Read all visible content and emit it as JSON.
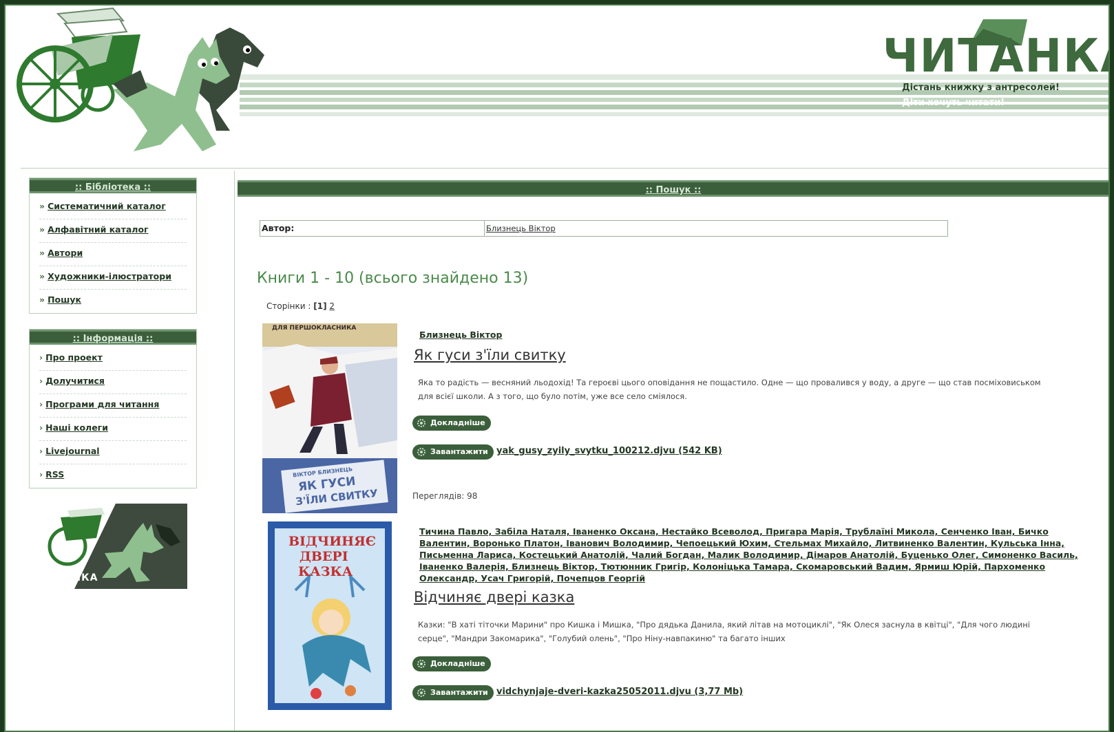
{
  "header": {
    "logo": "ЧИТАНКА",
    "tagline1": "Дістань книжку з антресолей!",
    "tagline2": "Діти хочуть читати!"
  },
  "sidebar": {
    "library": {
      "title": ":: Бібліотека ::",
      "items": [
        {
          "label": "Систематичний каталог"
        },
        {
          "label": "Алфавітний каталог"
        },
        {
          "label": "Автори"
        },
        {
          "label": "Художники-ілюстратори"
        },
        {
          "label": "Пошук"
        }
      ]
    },
    "info": {
      "title": ":: Інформація ::",
      "items": [
        {
          "label": "Про проект"
        },
        {
          "label": "Долучитися"
        },
        {
          "label": "Програми для читання"
        },
        {
          "label": "Наші колеги"
        },
        {
          "label": "Livejournal"
        },
        {
          "label": "RSS"
        }
      ]
    },
    "banner_label": "ЧИТАНКА"
  },
  "main": {
    "title": ":: Пошук ::",
    "author_label": "Автор:",
    "author_value": "Близнець Віктор",
    "result_count": "Книги 1 - 10 (всього знайдено 13)",
    "pager": {
      "prefix": "Сторінки :",
      "current": "[1]",
      "next": "2"
    },
    "books": [
      {
        "authors": "Близнець Віктор",
        "title": "Як гуси з'їли свитку",
        "description": "Яка то радість — весняний льодохід! Та героєві цього оповідання не пощастило. Одне — що провалився у воду, а друге — що став посміховиськом для всієї школи. А з того, що було потім, уже все село сміялося.",
        "more_label": "Докладніше",
        "download_label": "Завантажити",
        "file": "yak_gusy_zyily_svytku_100212.djvu (542 KB)",
        "views": "Переглядів: 98",
        "cover_top": "ДЛЯ ПЕРШОКЛАСНИКА",
        "cover_author": "ВІКТОР БЛИЗНЕЦЬ",
        "cover_title1": "ЯК ГУСИ",
        "cover_title2": "З'ЇЛИ СВИТКУ"
      },
      {
        "authors": "Тичина Павло, Забіла Наталя, Іваненко Оксана, Нестайко Всеволод, Пригара Марія, Трублаїні Микола, Сенченко Іван, Бичко Валентин, Воронько Платон, Іванович Володимир, Чепоецький Юхим, Стельмах Михайло, Литвиненко Валентин, Кульська Інна, Письменна Лариса, Костецький Анатолій, Чалий Богдан, Малик Володимир, Дімаров Анатолій, Буценько Олег, Симоненко Василь, Іваненко Валерія, Близнець Віктор, Тютюнник Григір, Колоніцька Тамара, Скомаровський Вадим, Ярмиш Юрій, Пархоменко Олександр, Усач Григорій, Почепцов Георгій",
        "title": "Відчиняє двері казка",
        "description": "Казки: \"В хаті тіточки Марини\" про Кишка і Мишка, \"Про дядька Данила, який літав на мотоциклі\", \"Як Олеся заснула в квітці\", \"Для чого людині серце\", \"Мандри Закомарика\", \"Голубий олень\", \"Про Ніну-навпакиню\" та багато інших",
        "more_label": "Докладніше",
        "download_label": "Завантажити",
        "file": "vidchynjaje-dveri-kazka25052011.djvu (3,77 Mb)",
        "cover_title1": "ВІДЧИНЯЄ",
        "cover_title2": "ДВЕРІ",
        "cover_title3": "КАЗКА"
      }
    ]
  },
  "colors": {
    "dark_green": "#3b5f3b",
    "light_green": "#8fb48f",
    "accent_green": "#4a8a4a",
    "outer_bg": "#1e3a1e"
  }
}
